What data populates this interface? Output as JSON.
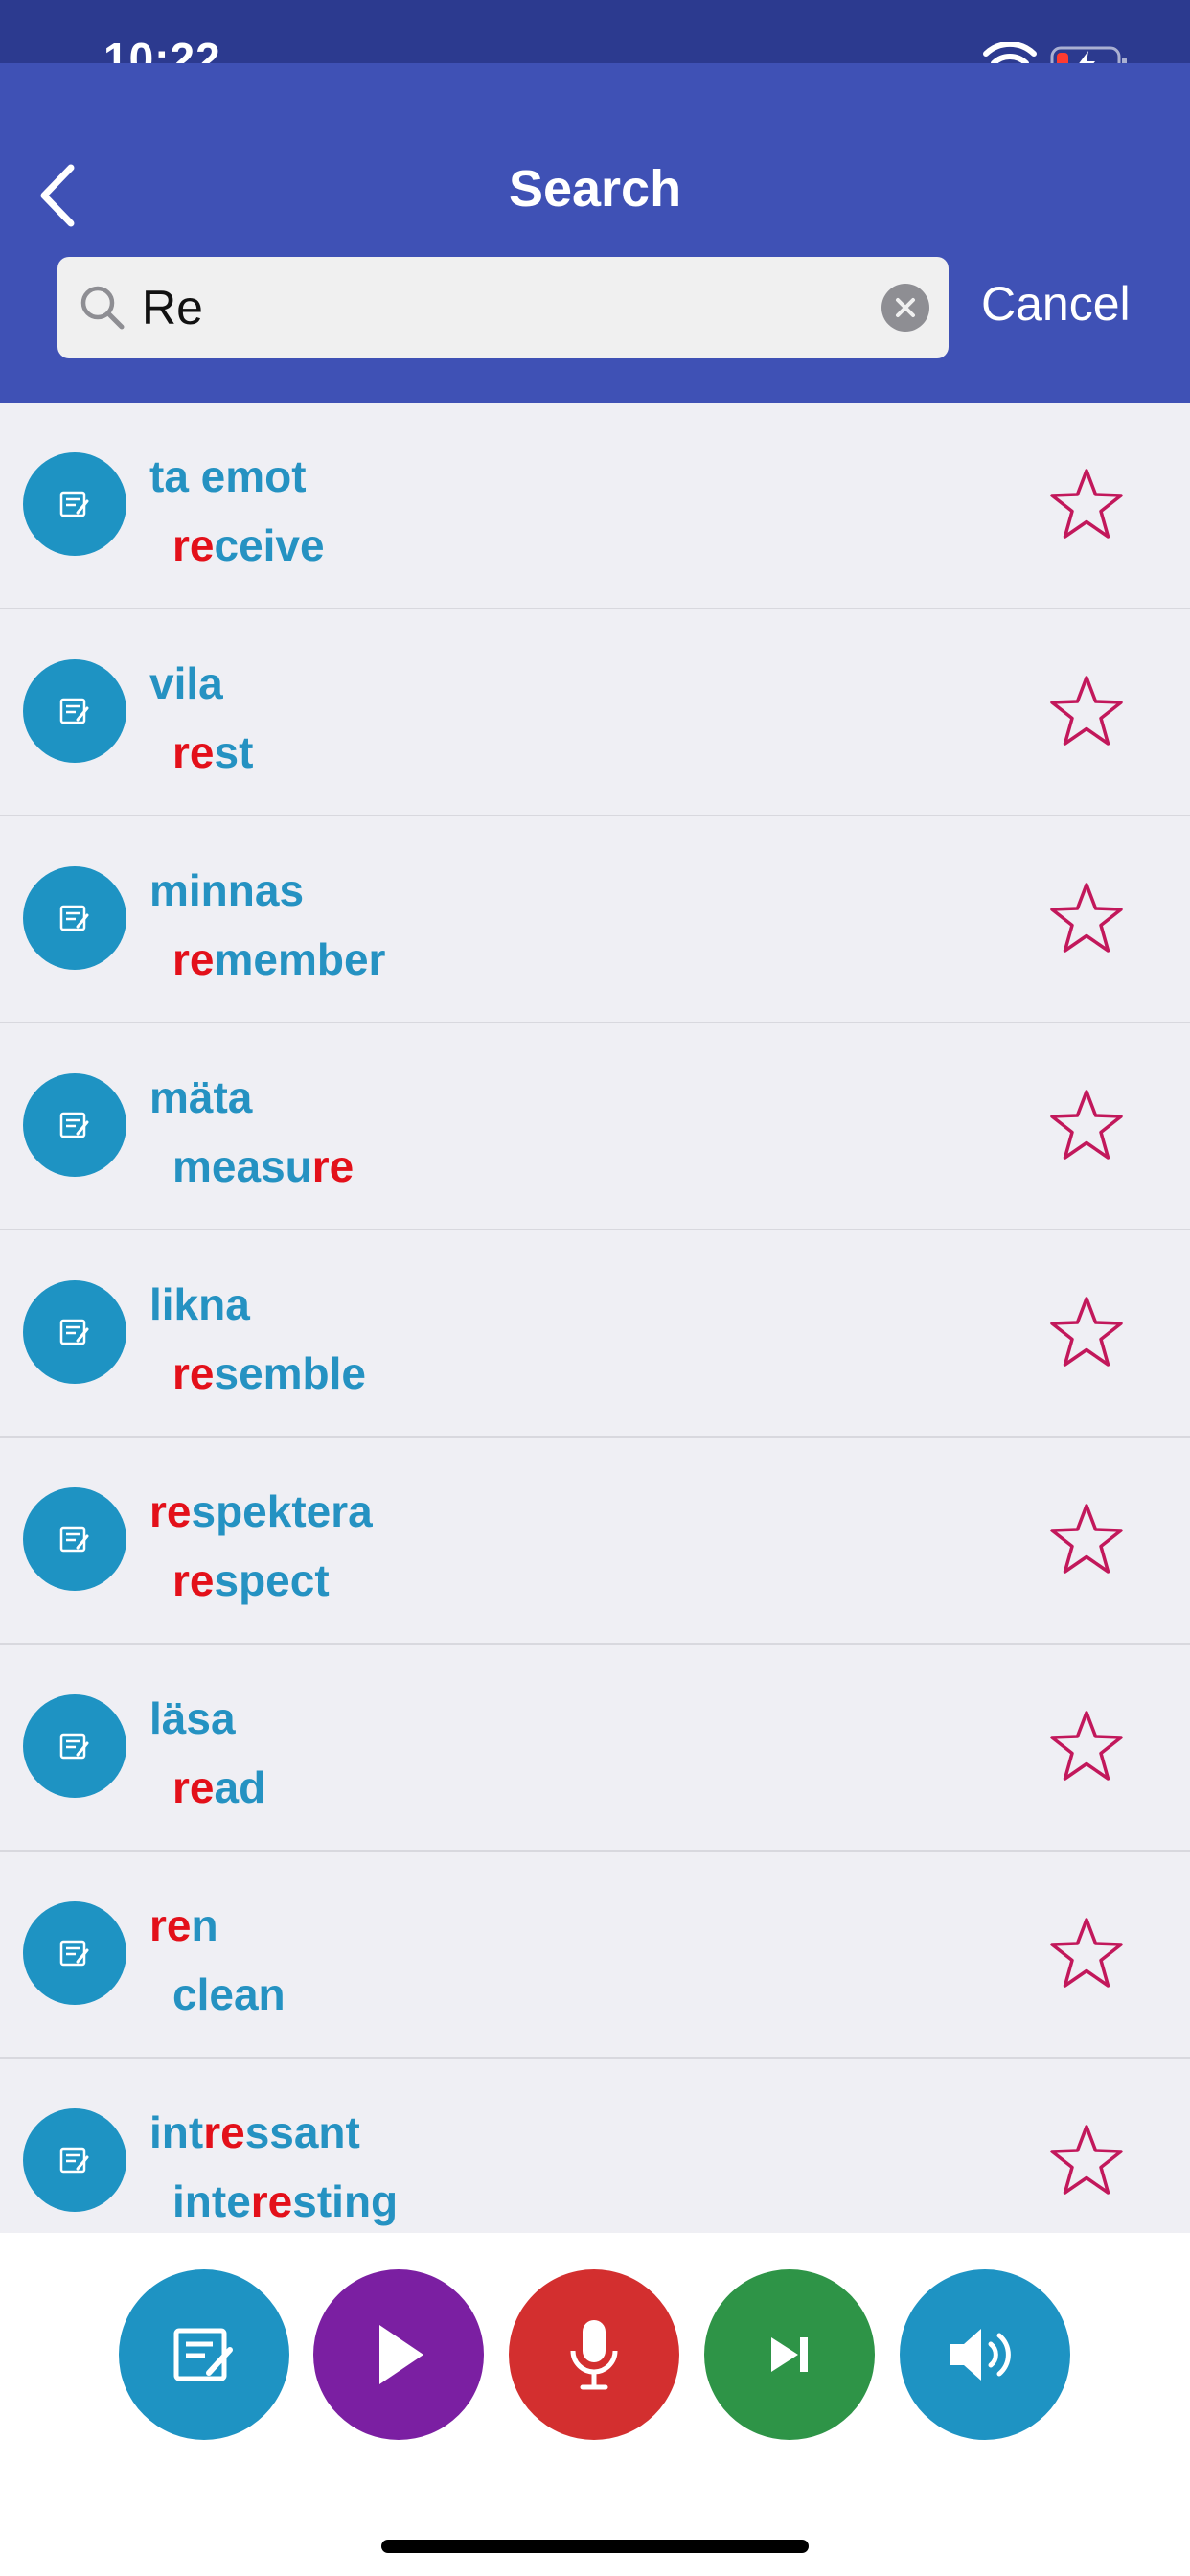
{
  "status": {
    "time": "10:22"
  },
  "header": {
    "title": "Search"
  },
  "search": {
    "value": "Re",
    "placeholder": "",
    "cancel_label": "Cancel"
  },
  "results": [
    {
      "sv": [
        {
          "t": "ta emot",
          "h": false
        }
      ],
      "en": [
        {
          "t": "re",
          "h": true
        },
        {
          "t": "ceive",
          "h": false
        }
      ]
    },
    {
      "sv": [
        {
          "t": "vila",
          "h": false
        }
      ],
      "en": [
        {
          "t": "re",
          "h": true
        },
        {
          "t": "st",
          "h": false
        }
      ]
    },
    {
      "sv": [
        {
          "t": "minnas",
          "h": false
        }
      ],
      "en": [
        {
          "t": "re",
          "h": true
        },
        {
          "t": "member",
          "h": false
        }
      ]
    },
    {
      "sv": [
        {
          "t": "mäta",
          "h": false
        }
      ],
      "en": [
        {
          "t": "measu",
          "h": false
        },
        {
          "t": "re",
          "h": true
        }
      ]
    },
    {
      "sv": [
        {
          "t": "likna",
          "h": false
        }
      ],
      "en": [
        {
          "t": "re",
          "h": true
        },
        {
          "t": "semble",
          "h": false
        }
      ]
    },
    {
      "sv": [
        {
          "t": "re",
          "h": true
        },
        {
          "t": "spektera",
          "h": false
        }
      ],
      "en": [
        {
          "t": "re",
          "h": true
        },
        {
          "t": "spect",
          "h": false
        }
      ]
    },
    {
      "sv": [
        {
          "t": "läsa",
          "h": false
        }
      ],
      "en": [
        {
          "t": "re",
          "h": true
        },
        {
          "t": "ad",
          "h": false
        }
      ]
    },
    {
      "sv": [
        {
          "t": "re",
          "h": true
        },
        {
          "t": "n",
          "h": false
        }
      ],
      "en": [
        {
          "t": "clean",
          "h": false
        }
      ]
    },
    {
      "sv": [
        {
          "t": "int",
          "h": false
        },
        {
          "t": "re",
          "h": true
        },
        {
          "t": "ssant",
          "h": false
        }
      ],
      "en": [
        {
          "t": "inte",
          "h": false
        },
        {
          "t": "re",
          "h": true
        },
        {
          "t": "sting",
          "h": false
        }
      ]
    }
  ],
  "icons": {
    "item": "note-edit-icon",
    "favorite": "star-outline-icon",
    "toolbar": [
      "note-edit-icon",
      "play-icon",
      "microphone-icon",
      "skip-next-icon",
      "speaker-icon"
    ]
  },
  "colors": {
    "header_bg": "#3f51b5",
    "status_bg": "#2c3a8f",
    "word_text": "#2592c2",
    "highlight": "#e3101a",
    "star": "#c2185b",
    "btn_edit": "#1e93c3",
    "btn_play": "#7b1fa2",
    "btn_mic": "#d32f2f",
    "btn_skip": "#2e9447",
    "btn_sound": "#1e93c3"
  }
}
